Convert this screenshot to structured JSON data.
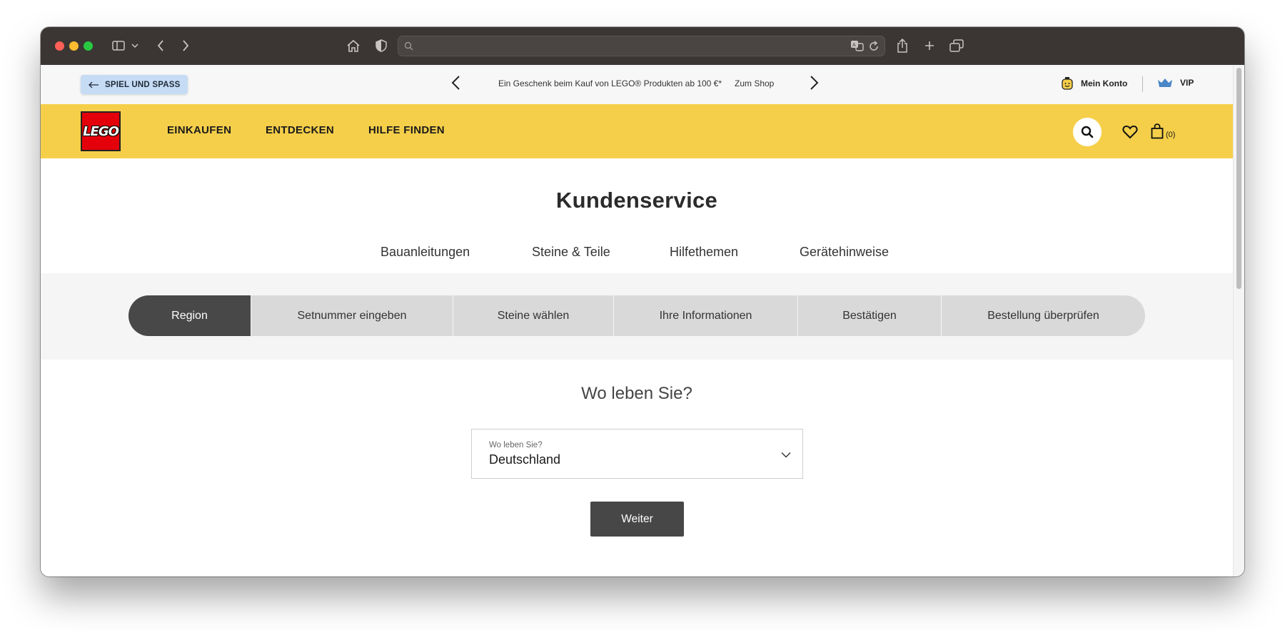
{
  "browser": {
    "url": "",
    "icons": [
      "sidebar-icon",
      "chevron-down-icon",
      "back-icon",
      "forward-icon",
      "home-icon",
      "shield-icon",
      "search-icon",
      "translate-icon",
      "reload-icon",
      "share-icon",
      "new-tab-icon",
      "tabs-overview-icon"
    ]
  },
  "promo": {
    "back_label": "SPIEL UND SPASS",
    "message": "Ein Geschenk beim Kauf von LEGO® Produkten ab 100 €*",
    "link": "Zum Shop",
    "account_label": "Mein Konto",
    "vip_label": "VIP"
  },
  "nav": {
    "logo_text": "LEGO",
    "links": [
      "EINKAUFEN",
      "ENTDECKEN",
      "HILFE FINDEN"
    ],
    "cart_count": "(0)"
  },
  "page": {
    "title": "Kundenservice",
    "subnav": [
      "Bauanleitungen",
      "Steine & Teile",
      "Hilfethemen",
      "Gerätehinweise"
    ]
  },
  "steps": [
    {
      "label": "Region",
      "active": true
    },
    {
      "label": "Setnummer eingeben",
      "active": false
    },
    {
      "label": "Steine wählen",
      "active": false
    },
    {
      "label": "Ihre Informationen",
      "active": false
    },
    {
      "label": "Bestätigen",
      "active": false
    },
    {
      "label": "Bestellung überprüfen",
      "active": false
    }
  ],
  "form": {
    "question": "Wo leben Sie?",
    "select_label": "Wo leben Sie?",
    "select_value": "Deutschland",
    "submit_label": "Weiter"
  },
  "colors": {
    "nav_yellow": "#f5cf4a",
    "lego_red": "#e3000b",
    "active_step": "#484848",
    "back_pill": "#c6dcf5"
  }
}
